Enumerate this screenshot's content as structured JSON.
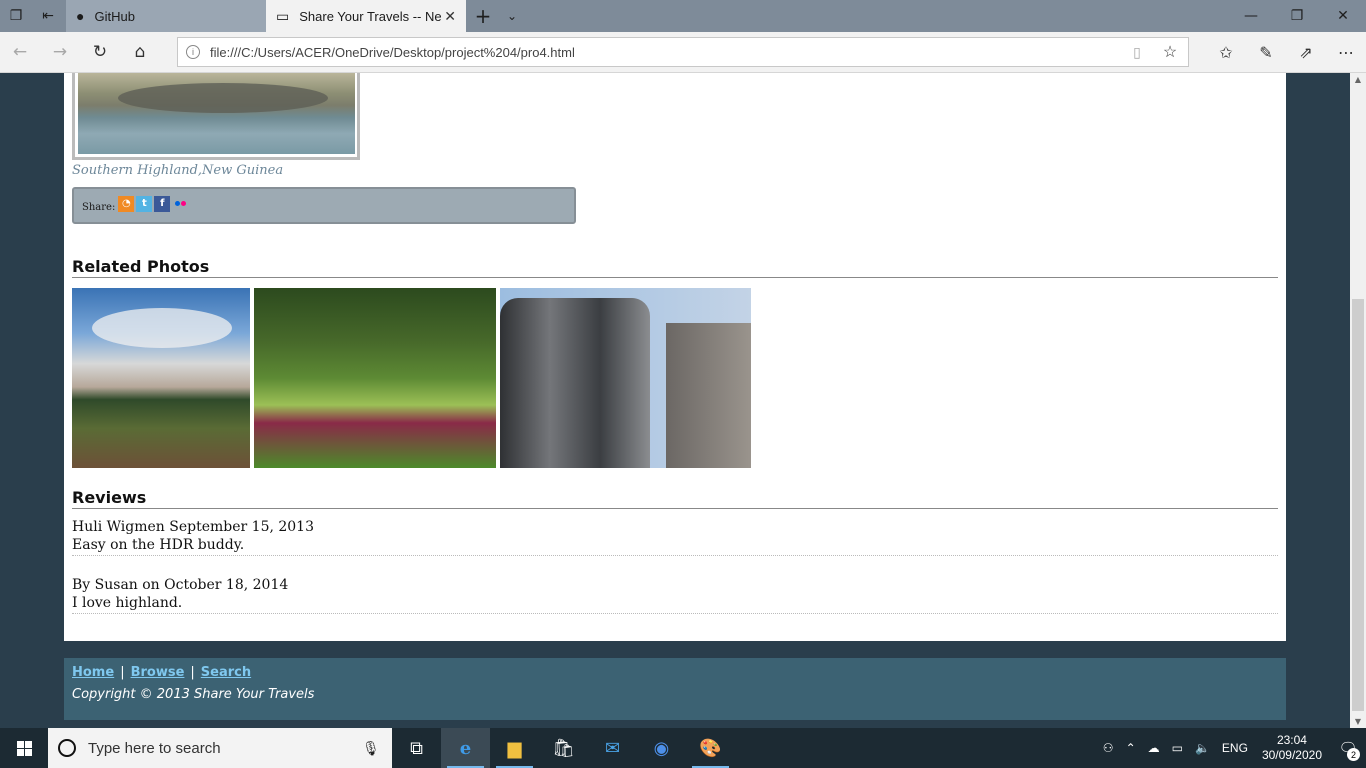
{
  "browser": {
    "tabs": [
      {
        "title": "GitHub",
        "icon": "github-icon",
        "active": false
      },
      {
        "title": "Share Your Travels -- Ne",
        "icon": "page-icon",
        "active": true
      }
    ],
    "address": "file:///C:/Users/ACER/OneDrive/Desktop/project%204/pro4.html"
  },
  "page": {
    "photo_caption": "Southern Highland,New Guinea",
    "share_label": "Share:",
    "share_icons": [
      "rss-icon",
      "twitter-icon",
      "facebook-icon",
      "flickr-icon"
    ],
    "related_heading": "Related Photos",
    "reviews_heading": "Reviews",
    "reviews": [
      {
        "byline": "Huli Wigmen September 15, 2013",
        "text": "Easy on the HDR buddy."
      },
      {
        "byline": "By Susan on October 18, 2014",
        "text": "I love highland."
      }
    ],
    "footer": {
      "links": [
        "Home",
        "Browse",
        "Search"
      ],
      "separator": "|",
      "copyright": "Copyright © 2013 Share Your Travels"
    }
  },
  "taskbar": {
    "search_placeholder": "Type here to search",
    "language": "ENG",
    "time": "23:04",
    "date": "30/09/2020",
    "notification_count": "2"
  },
  "colors": {
    "page_background": "#2a3e4c",
    "footer_background": "#3c6273",
    "footer_link": "#7fc8ef",
    "caption": "#6d8799",
    "share_panel": "#9daab3"
  }
}
